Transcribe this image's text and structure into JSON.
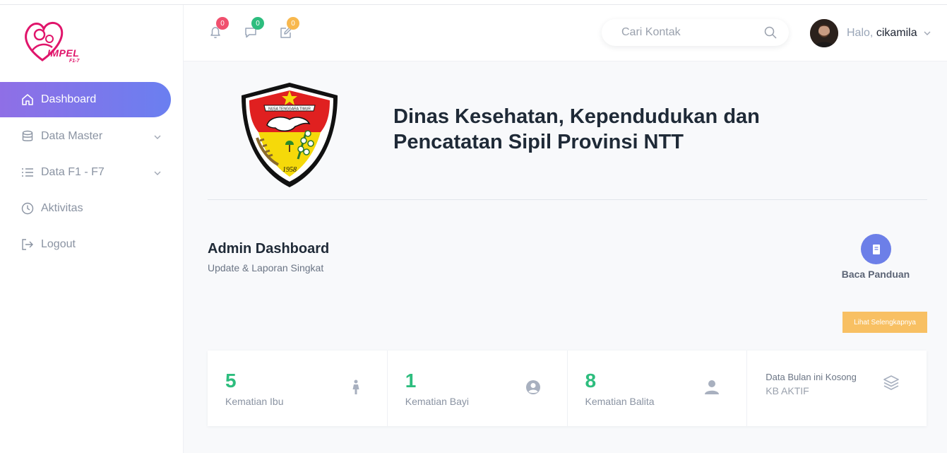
{
  "brand": {
    "logo_text": "IMPEL",
    "logo_sub": "F1-7"
  },
  "sidebar": {
    "items": [
      {
        "label": "Dashboard",
        "icon": "home-icon",
        "active": true
      },
      {
        "label": "Data Master",
        "icon": "database-icon",
        "has_submenu": true
      },
      {
        "label": "Data F1 - F7",
        "icon": "list-icon",
        "has_submenu": true
      },
      {
        "label": "Aktivitas",
        "icon": "clock-icon"
      },
      {
        "label": "Logout",
        "icon": "logout-icon"
      }
    ]
  },
  "header": {
    "notifications": [
      {
        "icon": "bell-icon",
        "count": "0",
        "color": "#f0506e"
      },
      {
        "icon": "chat-icon",
        "count": "0",
        "color": "#2dbd7e"
      },
      {
        "icon": "edit-icon",
        "count": "0",
        "color": "#f8b84e"
      }
    ],
    "search": {
      "placeholder": "Cari Kontak"
    },
    "user": {
      "greeting": "Halo,",
      "name": "cikamila"
    }
  },
  "main": {
    "emblem_year": "1958",
    "emblem_ribbon": "NUSA TENGGARA TIMUR",
    "agency_name_line1": "Dinas Kesehatan, Kependudukan dan",
    "agency_name_line2": "Pencatatan Sipil Provinsi NTT",
    "title": "Admin Dashboard",
    "subtitle": "Update & Laporan Singkat",
    "guide_label": "Baca Panduan",
    "more_button": "Lihat Selengkapnya",
    "stats": [
      {
        "value": "5",
        "label": "Kematian Ibu",
        "icon": "female-icon"
      },
      {
        "value": "1",
        "label": "Kematian Bayi",
        "icon": "user-circle-icon"
      },
      {
        "value": "8",
        "label": "Kematian Balita",
        "icon": "user-icon"
      },
      {
        "line1": "Data Bulan ini Kosong",
        "line2": "KB AKTIF",
        "icon": "layers-icon"
      }
    ]
  },
  "colors": {
    "accent_gradient_start": "#8f6fe6",
    "accent_gradient_end": "#6a7ff0",
    "stat_value": "#2dbd7e",
    "more_button": "#f8c063"
  }
}
